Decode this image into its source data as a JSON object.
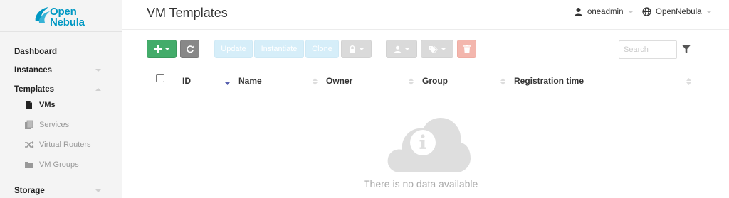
{
  "brand": {
    "line1": "Open",
    "line2": "Nebula",
    "color": "#0098c3"
  },
  "sidebar": {
    "items": [
      {
        "label": "Dashboard"
      },
      {
        "label": "Instances"
      },
      {
        "label": "Templates"
      },
      {
        "label": "Storage"
      }
    ],
    "template_subitems": [
      {
        "label": "VMs",
        "icon": "file-icon",
        "active": true
      },
      {
        "label": "Services",
        "icon": "copy-icon"
      },
      {
        "label": "Virtual Routers",
        "icon": "shuffle-icon"
      },
      {
        "label": "VM Groups",
        "icon": "folder-icon"
      }
    ]
  },
  "header": {
    "title": "VM Templates",
    "user": "oneadmin",
    "zone": "OpenNebula"
  },
  "toolbar": {
    "update_label": "Update",
    "instantiate_label": "Instantiate",
    "clone_label": "Clone",
    "search_placeholder": "Search",
    "colors": {
      "create": "#43ac6a",
      "refresh": "#888888",
      "light": "#d6eef9",
      "delete": "#f3b6ad"
    }
  },
  "table": {
    "columns": [
      "ID",
      "Name",
      "Owner",
      "Group",
      "Registration time"
    ],
    "empty_message": "There is no data available"
  }
}
